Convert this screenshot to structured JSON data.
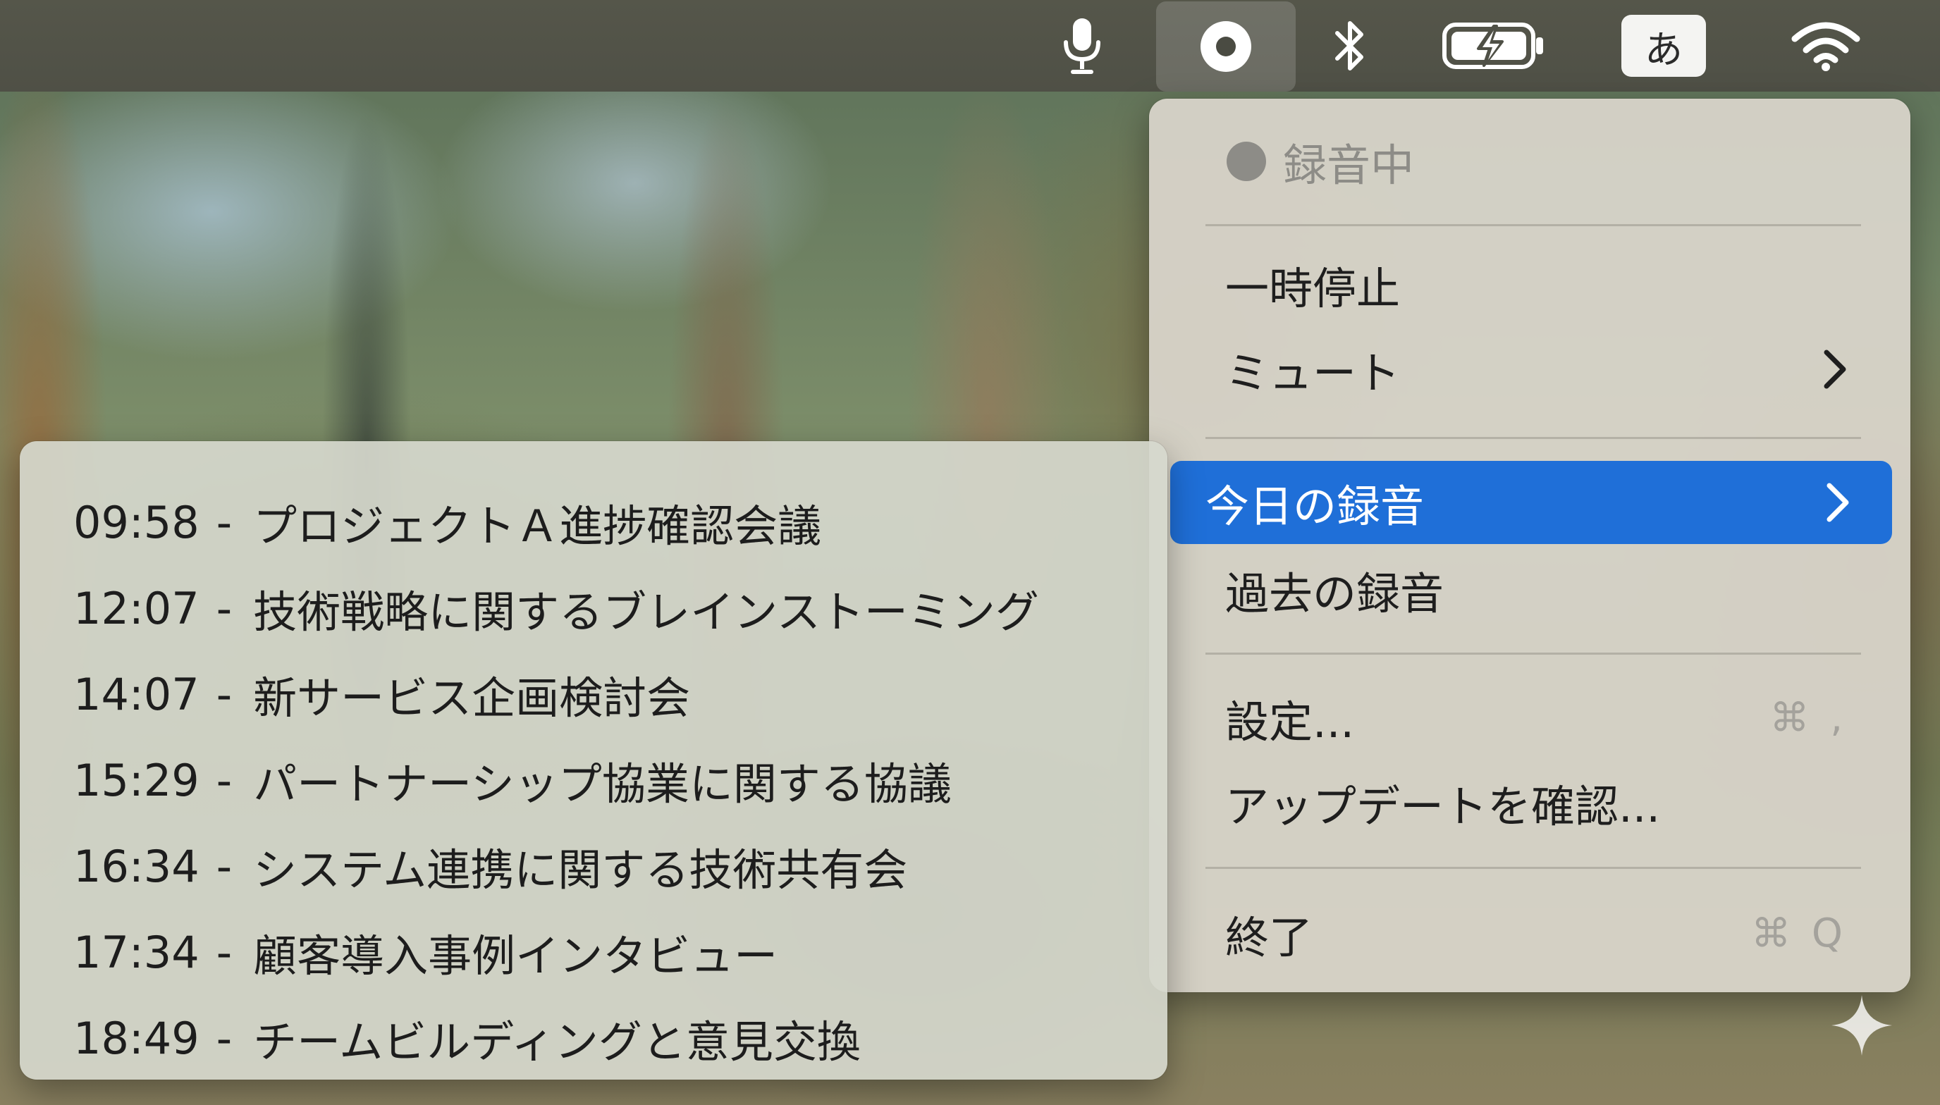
{
  "menubar": {
    "icons": [
      "microphone-icon",
      "record-status-icon",
      "bluetooth-icon",
      "battery-charging-icon",
      "input-method-icon",
      "wifi-icon"
    ],
    "input_method_label": "あ"
  },
  "menu": {
    "recording_status": "録音中",
    "pause": "一時停止",
    "mute": "ミュート",
    "todays_recordings": "今日の録音",
    "past_recordings": "過去の録音",
    "settings": "設定...",
    "settings_shortcut": "⌘ ,",
    "check_updates": "アップデートを確認...",
    "quit": "終了",
    "quit_shortcut": "⌘ Q"
  },
  "submenu": {
    "items": [
      {
        "time": "09:58",
        "title": "プロジェクトＡ進捗確認会議"
      },
      {
        "time": "12:07",
        "title": "技術戦略に関するブレインストーミング"
      },
      {
        "time": "14:07",
        "title": "新サービス企画検討会"
      },
      {
        "time": "15:29",
        "title": "パートナーシップ協業に関する協議"
      },
      {
        "time": "16:34",
        "title": "システム連携に関する技術共有会"
      },
      {
        "time": "17:34",
        "title": "顧客導入事例インタビュー"
      },
      {
        "time": "18:49",
        "title": "チームビルディングと意見交換"
      }
    ]
  },
  "colors": {
    "highlight": "#1f6fd8",
    "menu_background": "#dad6cc",
    "disabled_text": "#8d8c87"
  }
}
